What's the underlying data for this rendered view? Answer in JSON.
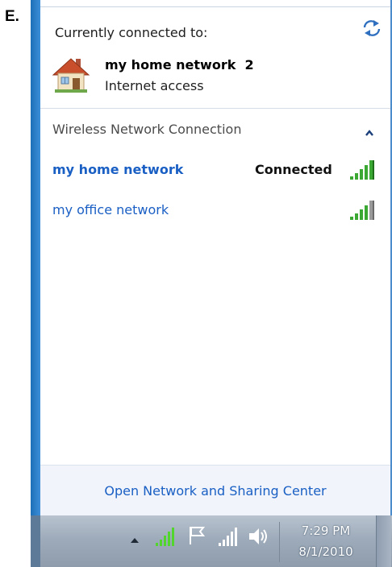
{
  "step_label": "E.",
  "flyout": {
    "header_title": "Currently connected to:",
    "current_network": {
      "name": "my home network  2",
      "status": "Internet access",
      "icon": "house-icon"
    },
    "section": {
      "title": "Wireless Network Connection",
      "icon": "chevron-up-icon"
    },
    "networks": [
      {
        "name": "my home network",
        "status": "Connected",
        "icon": "signal-strength-icon"
      },
      {
        "name": "my office network",
        "status": "",
        "icon": "signal-strength-icon"
      }
    ],
    "footer_link": "Open Network and Sharing Center"
  },
  "taskbar": {
    "tray_icons": [
      "show-hidden-icons-arrow-icon",
      "wireless-signal-icon",
      "action-center-flag-icon",
      "network-signal-icon",
      "volume-icon"
    ],
    "time": "7:29 PM",
    "date": "8/1/2010"
  },
  "colors": {
    "link_blue": "#1a5fc4",
    "signal_green": "#3aa832",
    "taskbar": "#9eabba",
    "desktop_blue": "#1d6fb8"
  }
}
